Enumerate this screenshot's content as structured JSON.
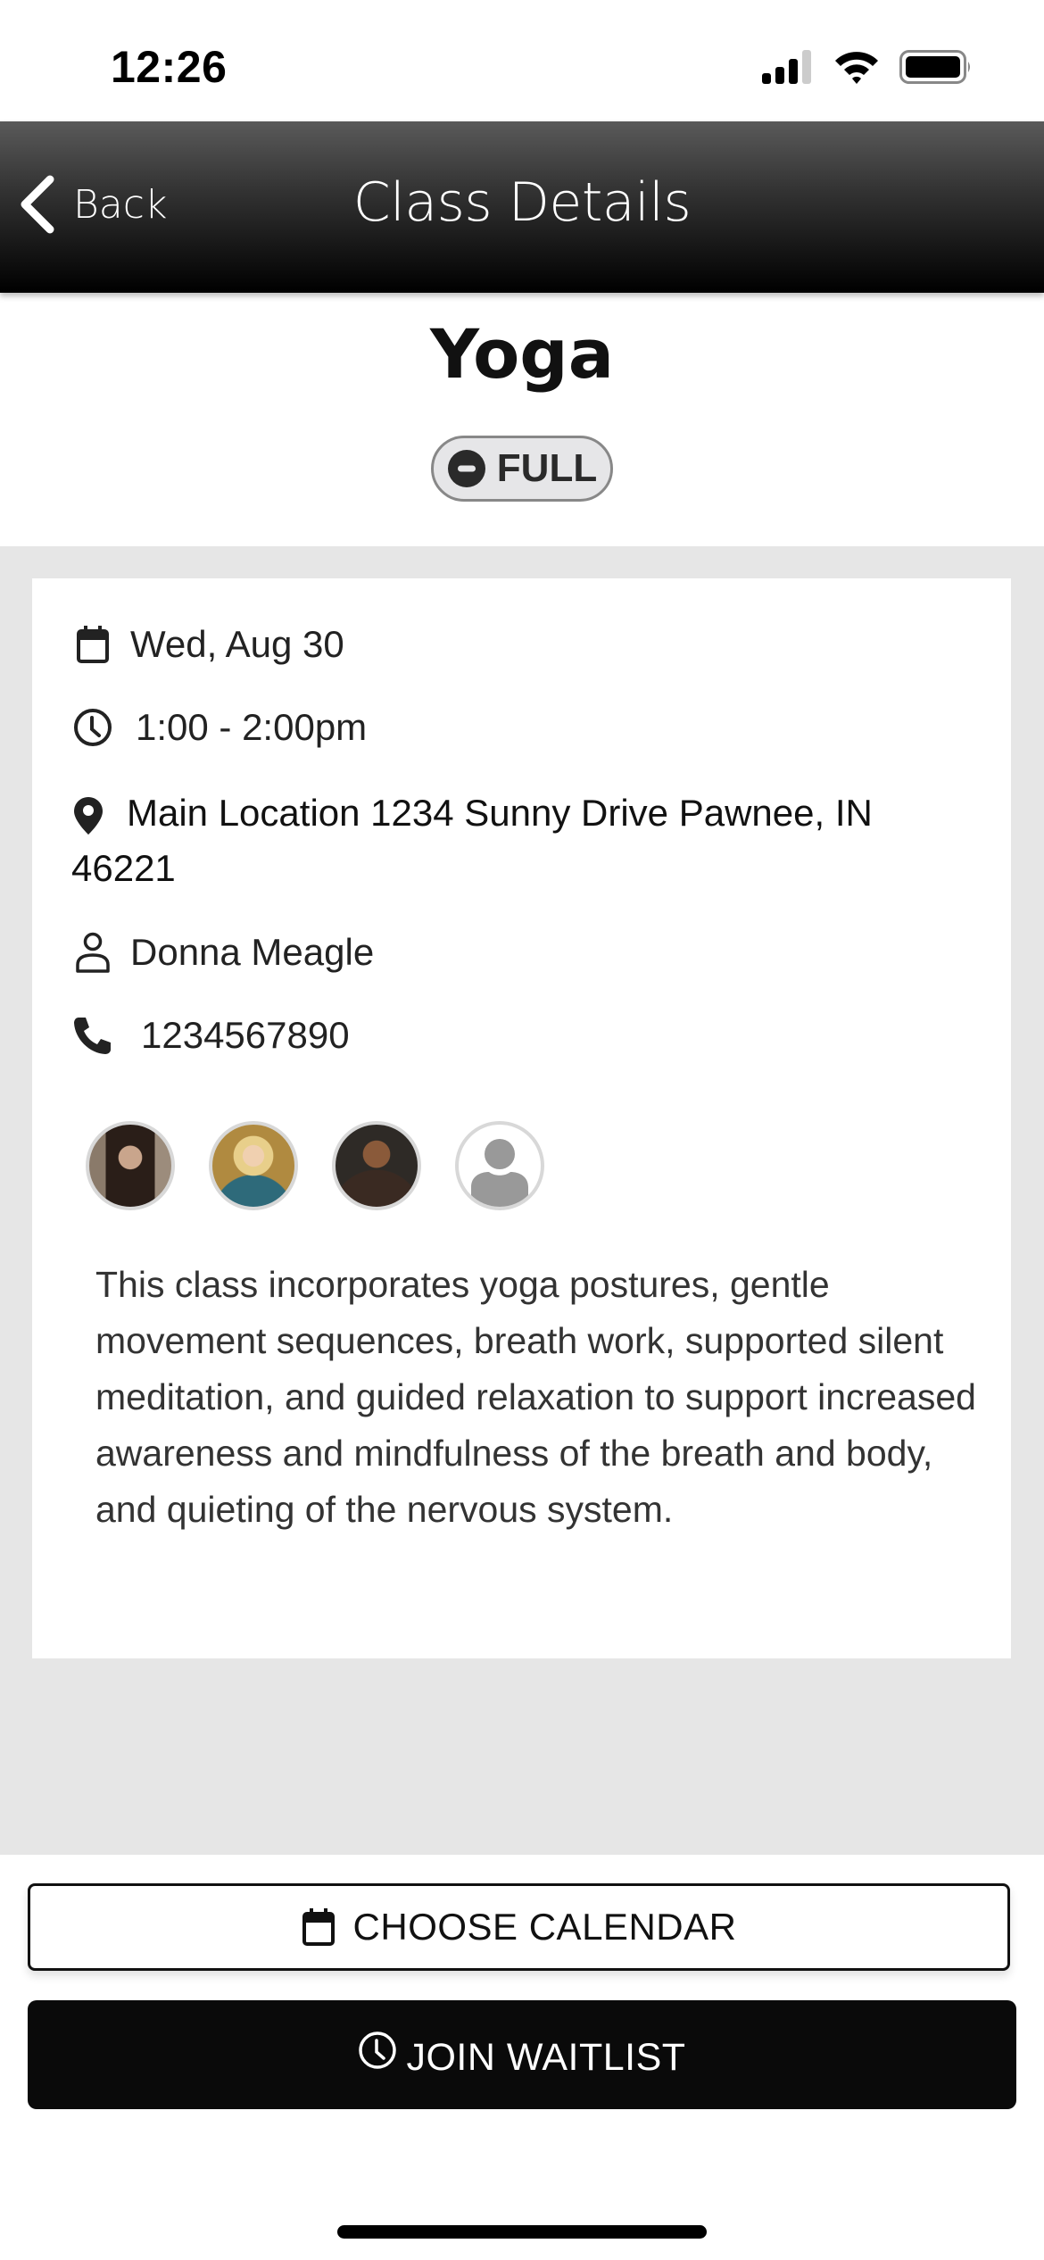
{
  "status_bar": {
    "time": "12:26",
    "icons": [
      "cellular-signal-icon",
      "wifi-icon",
      "battery-icon"
    ]
  },
  "nav": {
    "back_label": "Back",
    "title": "Class Details"
  },
  "class": {
    "name": "Yoga",
    "status_badge": "FULL",
    "date": "Wed, Aug 30",
    "time": "1:00 - 2:00pm",
    "location": "Main Location 1234 Sunny Drive Pawnee, IN 46221",
    "instructor": "Donna Meagle",
    "phone": "1234567890",
    "attendees": [
      {
        "type": "photo"
      },
      {
        "type": "photo"
      },
      {
        "type": "photo"
      },
      {
        "type": "placeholder"
      }
    ],
    "description": "This class incorporates yoga postures, gentle movement sequences, breath work, supported silent meditation, and guided relaxation to support increased awareness and mindfulness of the breath and body, and quieting of the nervous system."
  },
  "actions": {
    "choose_calendar_label": "CHOOSE CALENDAR",
    "join_waitlist_label": "JOIN WAITLIST"
  },
  "colors": {
    "primary": "#0a0a0a",
    "badge_bg": "#e6e6e8",
    "page_bg": "#e6e6e6"
  }
}
